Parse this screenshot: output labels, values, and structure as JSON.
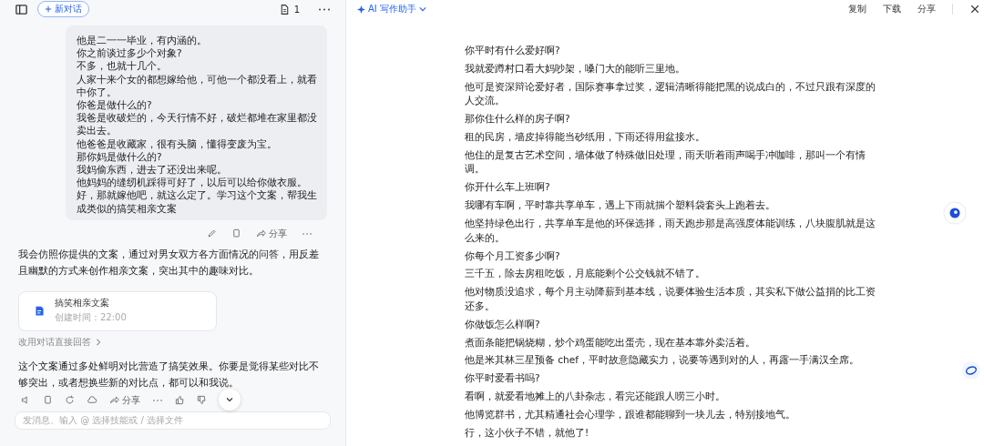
{
  "left_panel": {
    "new_chat_button": "新对话",
    "doc_count": "1",
    "user_message": [
      "他是二一一毕业，有内涵的。",
      "你之前谈过多少个对象?",
      "不多，也就十几个。",
      "人家十来个女的都想嫁给他，可他一个都没看上，就看中你了。",
      "你爸是做什么的?",
      "我爸是收破烂的，今天行情不好，破烂都堆在家里都没卖出去。",
      "他爸爸是收藏家，很有头脑，懂得变废为宝。",
      "那你妈是做什么的?",
      "我妈偷东西，进去了还没出来呢。",
      "他妈妈的缝纫机踩得可好了，以后可以给你做衣服。",
      "好，那就嫁他吧，就这么定了。学习这个文案，帮我生成类似的搞笑相亲文案"
    ],
    "user_actions": {
      "share": "分享"
    },
    "reply_intro": "我会仿照你提供的文案，通过对男女双方各方面情况的问答，用反差且幽默的方式来创作相亲文案，突出其中的趣味对比。",
    "doc_card": {
      "title": "搞笑相亲文案",
      "meta": "创建时间：22:00"
    },
    "switch_link": "改用对话直接回答",
    "reply_outro": "这个文案通过多处鲜明对比营造了搞笑效果。你要是觉得某些对比不够突出，或者想换些新的对比点，都可以和我说。",
    "reply_actions": {
      "share": "分享"
    },
    "input": {
      "placeholder": "发消息、输入 @ 选择技能或 / 选择文件"
    }
  },
  "editor": {
    "assistant_menu": "AI 写作助手",
    "toolbar": [
      "复制",
      "下载",
      "分享"
    ],
    "paragraphs": [
      "你平时有什么爱好啊?",
      "我就爱蹲村口看大妈吵架，嗓门大的能听三里地。",
      "他可是资深辩论爱好者，国际赛事拿过奖，逻辑清晰得能把黑的说成白的，不过只跟有深度的人交流。",
      "那你住什么样的房子啊?",
      "租的民房，墙皮掉得能当砂纸用，下雨还得用盆接水。",
      "他住的是复古艺术空间，墙体做了特殊做旧处理，雨天听着雨声喝手冲咖啡，那叫一个有情调。",
      "你开什么车上班啊?",
      "我哪有车啊，平时靠共享单车，遇上下雨就揣个塑料袋套头上跑着去。",
      "他坚持绿色出行，共享单车是他的环保选择，雨天跑步那是高强度体能训练，八块腹肌就是这么来的。",
      "你每个月工资多少啊?",
      "三千五，除去房租吃饭，月底能剩个公交钱就不错了。",
      "他对物质没追求，每个月主动降薪到基本线，说要体验生活本质，其实私下做公益捐的比工资还多。",
      "你做饭怎么样啊?",
      "煮面条能把锅烧糊，炒个鸡蛋能吃出蛋壳，现在基本靠外卖活着。",
      "他是米其林三星预备 chef，平时故意隐藏实力，说要等遇到对的人，再露一手满汉全席。",
      "你平时爱看书吗?",
      "看啊，就爱看地摊上的八卦杂志，看完还能跟人唠三小时。",
      "他博览群书，尤其精通社会心理学，跟谁都能聊到一块儿去，特别接地气。",
      "行，这小伙子不错，就他了!"
    ]
  }
}
